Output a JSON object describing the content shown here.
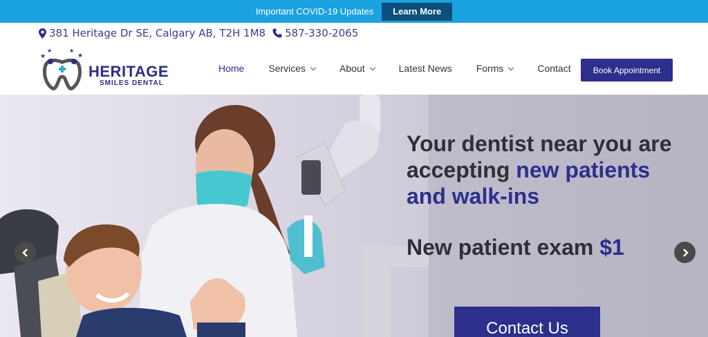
{
  "alert": {
    "text": "Important COVID-19 Updates",
    "button": "Learn More"
  },
  "contact": {
    "address": "381 Heritage Dr SE, Calgary AB, T2H 1M8",
    "phone": "587-330-2065"
  },
  "logo": {
    "title": "HERITAGE",
    "subtitle": "SMILES DENTAL"
  },
  "nav": {
    "items": [
      {
        "label": "Home"
      },
      {
        "label": "Services"
      },
      {
        "label": "About"
      },
      {
        "label": "Latest News"
      },
      {
        "label": "Forms"
      },
      {
        "label": "Contact"
      }
    ],
    "book_button": "Book Appointment"
  },
  "hero": {
    "line1": "Your dentist near you are",
    "line2_plain": "accepting ",
    "line2_hl": "new patients",
    "line3_hl": "and walk-ins",
    "offer_plain": "New patient exam ",
    "offer_hl": "$1",
    "cta": "Contact Us"
  },
  "colors": {
    "brand": "#2d2f8c",
    "alert": "#1aa3e0",
    "alert_button": "#0b4f7c"
  },
  "icons": [
    "map-marker-icon",
    "phone-icon",
    "chevron-left-icon",
    "chevron-right-icon",
    "chevron-down-icon"
  ]
}
